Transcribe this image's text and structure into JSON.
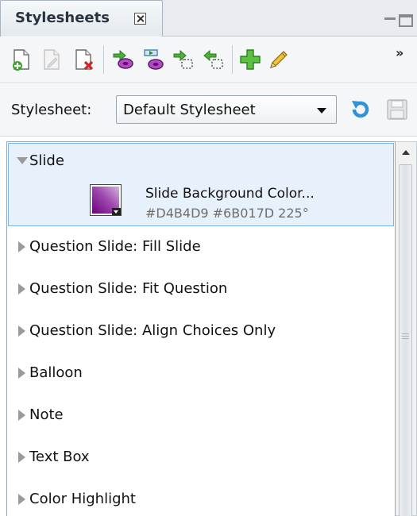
{
  "panel": {
    "tab_title": "Stylesheets"
  },
  "toolbar": {
    "buttons": [
      {
        "icon": "new-document-icon",
        "enabled": true
      },
      {
        "icon": "edit-document-icon",
        "enabled": false
      },
      {
        "icon": "delete-document-icon",
        "enabled": true
      },
      {
        "icon": "apply-style-icon",
        "enabled": true
      },
      {
        "icon": "import-style-icon",
        "enabled": true
      },
      {
        "icon": "copy-style-out-icon",
        "enabled": true
      },
      {
        "icon": "copy-style-in-icon",
        "enabled": true
      },
      {
        "icon": "add-style-icon",
        "enabled": true
      },
      {
        "icon": "pencil-icon",
        "enabled": true
      }
    ],
    "overflow_label": "»"
  },
  "stylesheet": {
    "label": "Stylesheet:",
    "selected": "Default Stylesheet"
  },
  "tree": {
    "items": [
      {
        "label": "Slide",
        "expanded": true,
        "selected": true,
        "property": {
          "name": "Slide Background Color...",
          "value": "#D4B4D9 #6B017D 225°",
          "color_start": "#D4B4D9",
          "color_end": "#6B017D"
        }
      },
      {
        "label": "Question Slide: Fill Slide",
        "expanded": false
      },
      {
        "label": "Question Slide: Fit Question",
        "expanded": false
      },
      {
        "label": "Question Slide: Align Choices Only",
        "expanded": false
      },
      {
        "label": "Balloon",
        "expanded": false
      },
      {
        "label": "Note",
        "expanded": false
      },
      {
        "label": "Text Box",
        "expanded": false
      },
      {
        "label": "Color Highlight",
        "expanded": false
      }
    ]
  },
  "colors": {
    "selection_bg": "#e7f1fb",
    "selection_border": "#7cb6e8",
    "muted_text": "#6e6e6e"
  }
}
